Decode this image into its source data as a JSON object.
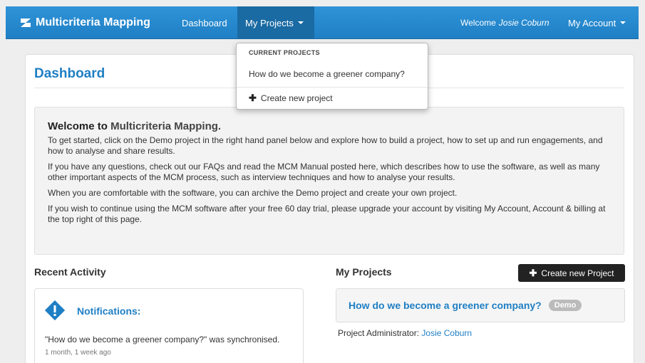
{
  "navbar": {
    "brand": "Multicriteria Mapping",
    "dashboard": "Dashboard",
    "my_projects": "My Projects",
    "welcome_prefix": "Welcome",
    "user_name": "Josie Coburn",
    "my_account": "My Account"
  },
  "dropdown": {
    "header": "CURRENT PROJECTS",
    "items": [
      {
        "label": "How do we become a greener company?"
      }
    ],
    "create_label": "Create new project"
  },
  "page": {
    "title": "Dashboard"
  },
  "welcome": {
    "heading_prefix": "Welcome to",
    "heading_brand": "Multicriteria Mapping.",
    "paragraphs": [
      "To get started, click on the Demo project in the right hand panel below and explore how to build a project, how to set up and run engagements, and how to analyse and share results.",
      "If you have any questions, check out our FAQs and read the MCM Manual posted here, which describes how to use the software, as well as many other important aspects of the MCM process, such as interview techniques and how to analyse your results.",
      "When you are comfortable with the software, you can archive the Demo project and create your own project.",
      "If you wish to continue using the MCM software after your free 60 day trial, please upgrade your account by visiting My Account, Account & billing at the top right of this page."
    ]
  },
  "recent_activity": {
    "title": "Recent Activity",
    "notifications_heading": "Notifications:",
    "items": [
      {
        "text": "\"How do we become a greener company?\" was synchronised.",
        "time": "1 month, 1 week ago"
      }
    ]
  },
  "my_projects": {
    "title": "My Projects",
    "create_button": "Create new Project",
    "projects": [
      {
        "name": "How do we become a greener company?",
        "badge": "Demo",
        "admin_label": "Project Administrator:",
        "admin_name": "Josie Coburn"
      }
    ]
  },
  "colors": {
    "brand_blue": "#1f7fc4",
    "navbar_active": "#1a6aa3",
    "button_dark": "#222222",
    "badge_grey": "#bbbbbb"
  }
}
